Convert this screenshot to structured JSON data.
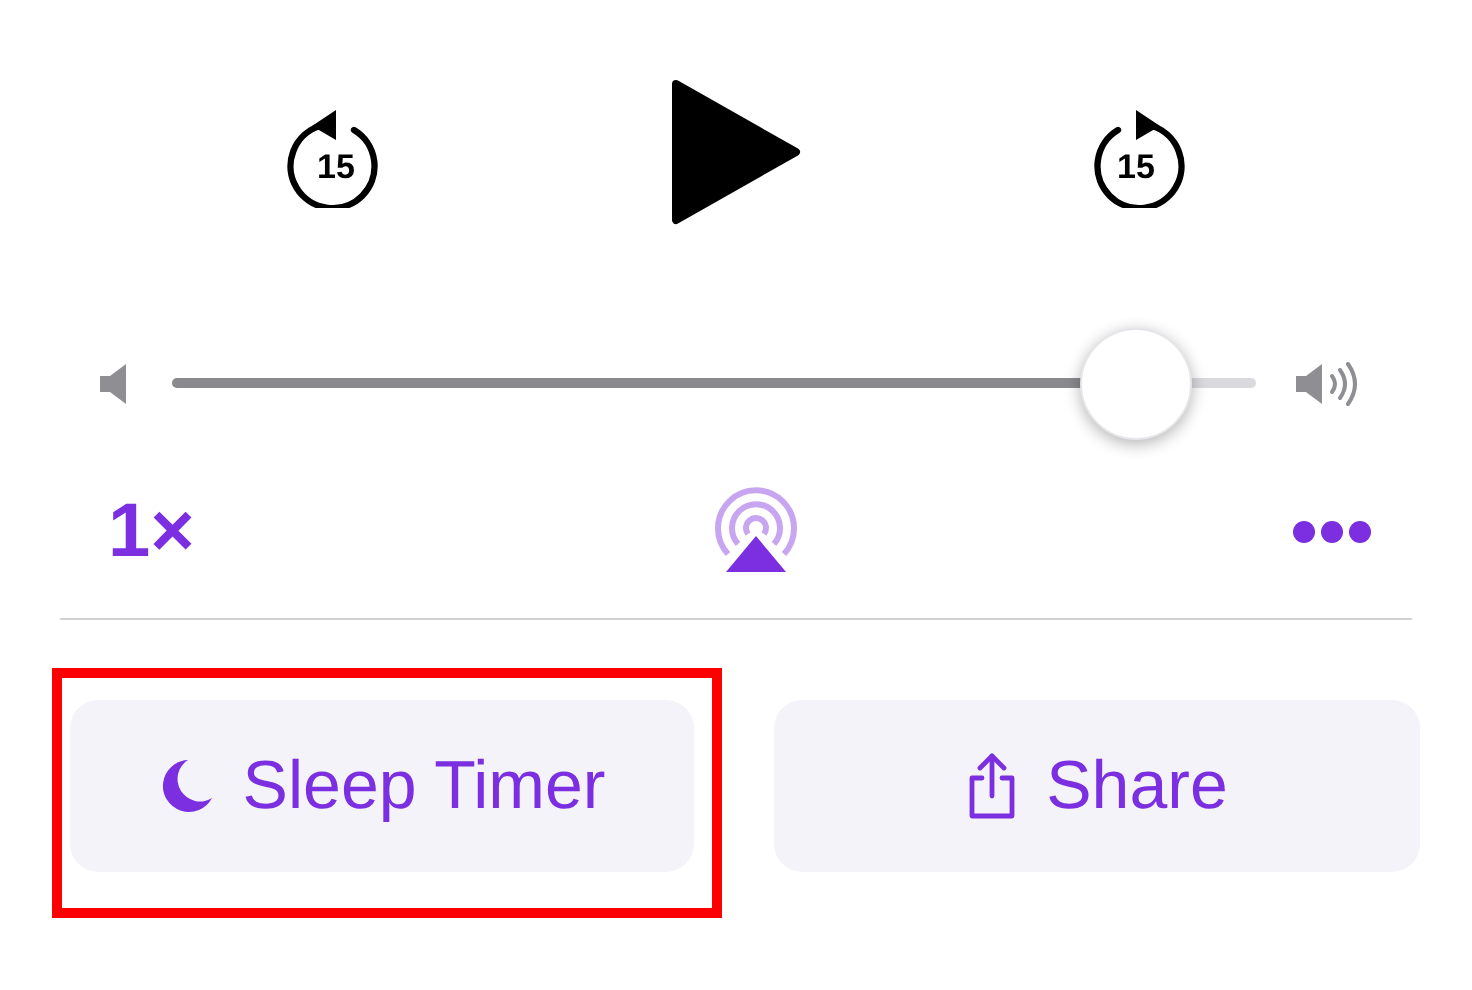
{
  "transport": {
    "skip_back": {
      "label": "15"
    },
    "play": {
      "playing": false
    },
    "skip_forward": {
      "label": "15"
    }
  },
  "volume": {
    "level": 0.89
  },
  "controls": {
    "speed": "1×"
  },
  "actions": [
    {
      "label": "Sleep Timer",
      "kind": "sleep",
      "highlighted": true
    },
    {
      "label": "Share",
      "kind": "share",
      "highlighted": false
    }
  ]
}
